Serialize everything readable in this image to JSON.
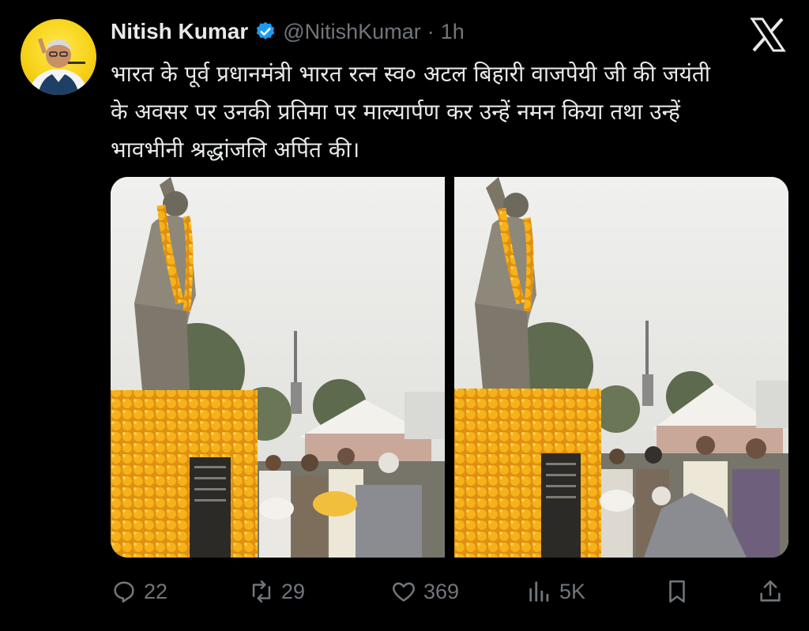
{
  "tweet": {
    "author_name": "Nitish Kumar",
    "handle": "@NitishKumar",
    "separator": "·",
    "time": "1h",
    "text_lines": [
      "भारत के पूर्व प्रधानमंत्री भारत रत्न स्व० अटल बिहारी वाजपेयी जी की जयंती",
      "के अवसर पर उनकी प्रतिमा पर माल्यार्पण कर उन्हें नमन किया तथा उन्हें",
      "भावभीनी श्रद्धांजलि अर्पित की।"
    ]
  },
  "actions": {
    "replies": "22",
    "reposts": "29",
    "likes": "369",
    "views": "5K"
  },
  "icons": {
    "verified": "verified-badge-icon",
    "platform": "x-logo-icon",
    "reply": "reply-icon",
    "repost": "repost-icon",
    "like": "heart-icon",
    "views": "views-icon",
    "bookmark": "bookmark-icon",
    "share": "share-icon"
  },
  "colors": {
    "background": "#000000",
    "text": "#e7e9ea",
    "muted": "#71767b",
    "verified_blue": "#1d9bf0",
    "avatar_yellow": "#f7d21a",
    "marigold": "#f2a516"
  }
}
